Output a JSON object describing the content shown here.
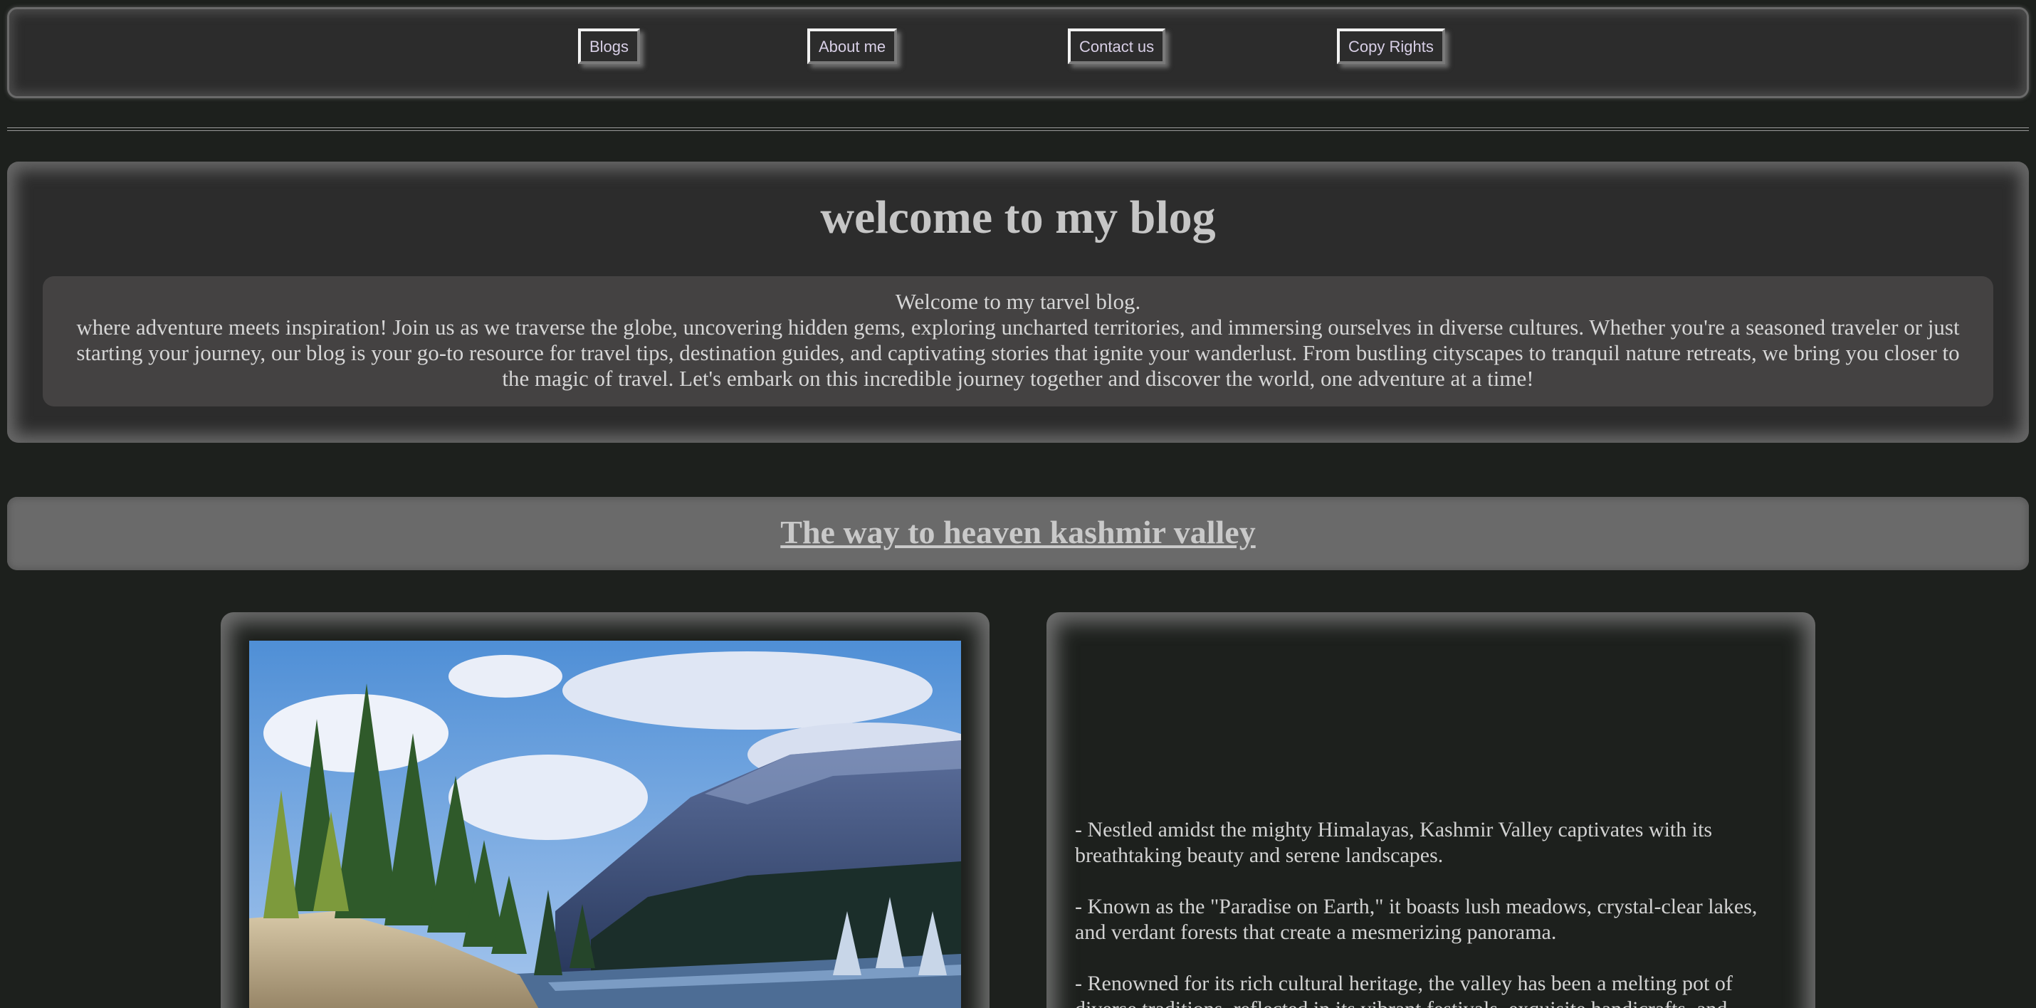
{
  "nav": {
    "items": [
      {
        "label": "Blogs"
      },
      {
        "label": "About me"
      },
      {
        "label": "Contact us"
      },
      {
        "label": "Copy Rights"
      }
    ]
  },
  "welcome": {
    "title": "welcome to my blog",
    "intro_line": "Welcome to my tarvel blog.",
    "body": "where adventure meets inspiration! Join us as we traverse the globe, uncovering hidden gems, exploring uncharted territories, and immersing ourselves in diverse cultures. Whether you're a seasoned traveler or just starting your journey, our blog is your go-to resource for travel tips, destination guides, and captivating stories that ignite your wanderlust. From bustling cityscapes to tranquil nature retreats, we bring you closer to the magic of travel. Let's embark on this incredible journey together and discover the world, one adventure at a time!"
  },
  "post": {
    "title": "The way to heaven kashmir valley",
    "points": [
      "- Nestled amidst the mighty Himalayas, Kashmir Valley captivates with its breathtaking beauty and serene landscapes.",
      "- Known as the \"Paradise on Earth,\" it boasts lush meadows, crystal-clear lakes, and verdant forests that create a mesmerizing panorama.",
      "- Renowned for its rich cultural heritage, the valley has been a melting pot of diverse traditions, reflected in its vibrant festivals, exquisite handicrafts, and"
    ]
  }
}
